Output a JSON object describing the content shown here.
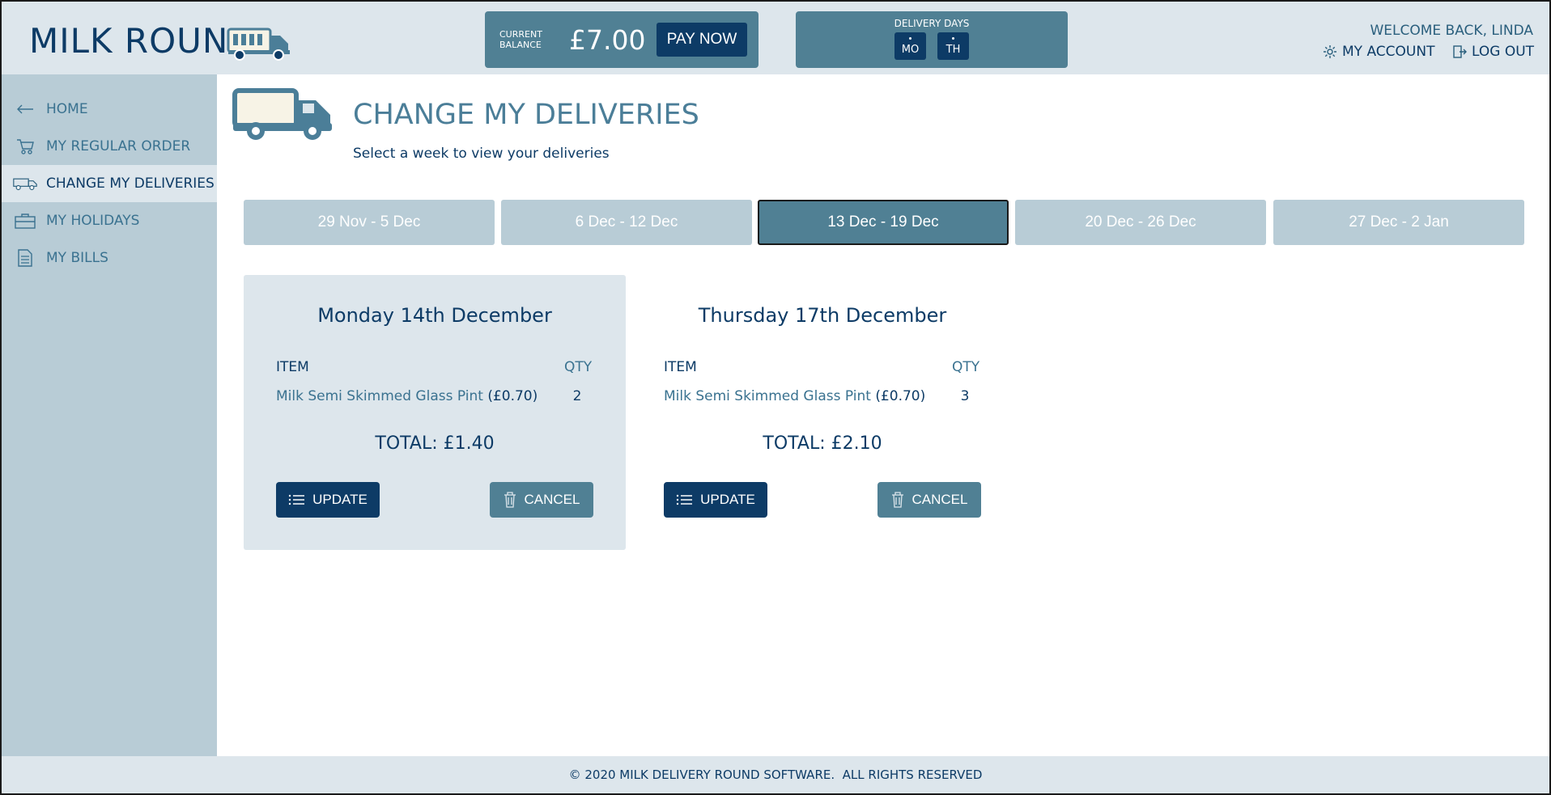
{
  "header": {
    "logo_text": "MILK ROUND",
    "balance_label_line1": "CURRENT",
    "balance_label_line2": "BALANCE",
    "balance_amount": "£7.00",
    "pay_now_label": "PAY NOW",
    "delivery_days_label": "DELIVERY DAYS",
    "delivery_days": [
      "MO",
      "TH"
    ],
    "welcome_text": "WELCOME BACK, LINDA",
    "my_account_label": "MY ACCOUNT",
    "log_out_label": "LOG OUT"
  },
  "sidebar": {
    "items": [
      {
        "label": "HOME",
        "icon": "arrow-left-icon"
      },
      {
        "label": "MY REGULAR ORDER",
        "icon": "cart-icon"
      },
      {
        "label": "CHANGE MY DELIVERIES",
        "icon": "van-icon"
      },
      {
        "label": "MY HOLIDAYS",
        "icon": "suitcase-icon"
      },
      {
        "label": "MY BILLS",
        "icon": "document-icon"
      }
    ],
    "active_index": 2
  },
  "main": {
    "title": "CHANGE MY DELIVERIES",
    "subtitle": "Select a week to view your deliveries",
    "weeks": [
      "29 Nov - 5 Dec",
      "6 Dec - 12 Dec",
      "13 Dec - 19 Dec",
      "20 Dec - 26 Dec",
      "27 Dec - 2 Jan"
    ],
    "active_week_index": 2,
    "deliveries": [
      {
        "date": "Monday 14th December",
        "item_header": "ITEM",
        "qty_header": "QTY",
        "item_name": "Milk Semi Skimmed Glass Pint",
        "item_price": "(£0.70)",
        "qty": "2",
        "total": "TOTAL: £1.40",
        "update_label": "UPDATE",
        "cancel_label": "CANCEL"
      },
      {
        "date": "Thursday 17th December",
        "item_header": "ITEM",
        "qty_header": "QTY",
        "item_name": "Milk Semi Skimmed Glass Pint",
        "item_price": "(£0.70)",
        "qty": "3",
        "total": "TOTAL: £2.10",
        "update_label": "UPDATE",
        "cancel_label": "CANCEL"
      }
    ]
  },
  "footer": {
    "text": "© 2020 MILK DELIVERY ROUND SOFTWARE.  ALL RIGHTS RESERVED"
  },
  "colors": {
    "navy": "#0d3b66",
    "steel": "#508094",
    "pale": "#dde6ec",
    "sidebar": "#b8ccd6"
  }
}
